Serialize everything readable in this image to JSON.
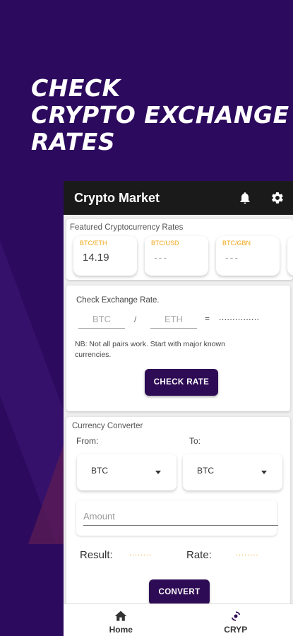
{
  "promo": {
    "headline_lines": [
      "CHECK",
      "CRYPTO EXCHANGE",
      "RATES"
    ]
  },
  "appbar": {
    "title": "Crypto Market",
    "icons": [
      "bell-icon",
      "gear-icon"
    ]
  },
  "featured": {
    "title": "Featured Cryptocurrency Rates",
    "tiles": [
      {
        "pair": "BTC/ETH",
        "value": "14.19"
      },
      {
        "pair": "BTC/USD",
        "value": "---"
      },
      {
        "pair": "BTC/GBN",
        "value": "---"
      }
    ]
  },
  "exchange": {
    "title": "Check Exchange Rate.",
    "from_placeholder": "BTC",
    "to_placeholder": "ETH",
    "separator": "/",
    "equals": "=",
    "result": "...............",
    "note": "NB: Not all pairs work. Start with major known currencies.",
    "button": "CHECK RATE"
  },
  "converter": {
    "title": "Currency Converter",
    "from_label": "From:",
    "to_label": "To:",
    "from_value": "BTC",
    "to_value": "BTC",
    "amount_placeholder": "Amount",
    "result_label": "Result:",
    "result_value": "........",
    "rate_label": "Rate:",
    "rate_value": "........",
    "button": "CONVERT"
  },
  "bottom_nav": {
    "items": [
      {
        "label": "Home",
        "icon": "home-icon"
      },
      {
        "label": "CRYP",
        "icon": "crypto-icon"
      }
    ]
  },
  "colors": {
    "background": "#2c0a5e",
    "appbar": "#1a1a1a",
    "button": "#2e0b55",
    "accent": "#f0a81a"
  }
}
